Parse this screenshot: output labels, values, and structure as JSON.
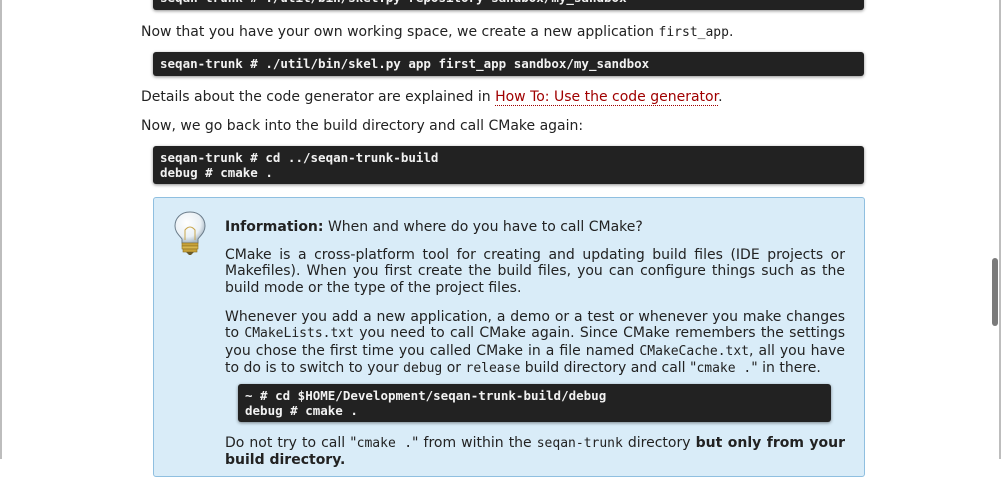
{
  "top_code": "seqan-trunk # ./util/bin/skel.py repository sandbox/my_sandbox",
  "p1": {
    "text": "Now that you have your own working space, we create a new application ",
    "code": "first_app",
    "end": "."
  },
  "code1": "seqan-trunk # ./util/bin/skel.py app first_app sandbox/my_sandbox",
  "p2": {
    "before": "Details about the code generator are explained in ",
    "link": "How To: Use the code generator",
    "after": "."
  },
  "p3": "Now, we go back into the build directory and call CMake again:",
  "code2": "seqan-trunk # cd ../seqan-trunk-build\ndebug # cmake .",
  "info": {
    "label": "Information:",
    "title": " When and where do you have to call CMake?",
    "para1": "CMake is a cross-platform tool for creating and updating build files (IDE projects or Makefiles). When you first create the build files, you can configure things such as the build mode or the type of the project files.",
    "para2": {
      "t1": "Whenever you add a new application, a demo or a test or whenever you make changes to ",
      "c1": "CMakeLists.txt",
      "t2": " you need to call CMake again. Since CMake remembers the settings you chose the first time you called CMake in a file named ",
      "c2": "CMakeCache.txt",
      "t3": ", all you have to do is to switch to your ",
      "c3": "debug",
      "t4": " or ",
      "c4": "release",
      "t5": " build directory and call \"",
      "c5": "cmake .",
      "t6": "\" in there."
    },
    "code": "~ # cd $HOME/Development/seqan-trunk-build/debug\ndebug # cmake .",
    "para3": {
      "t1": "Do not try to call \"",
      "c1": "cmake .",
      "t2": "\" from within the ",
      "c2": "seqan-trunk",
      "t3": " directory ",
      "bold": "but only from your build directory."
    }
  },
  "colors": {
    "code_bg": "#222222",
    "link": "#a00000",
    "info_bg": "#d9ecf8",
    "info_border": "#8fbfe0"
  },
  "icons": [
    "lightbulb-icon"
  ]
}
